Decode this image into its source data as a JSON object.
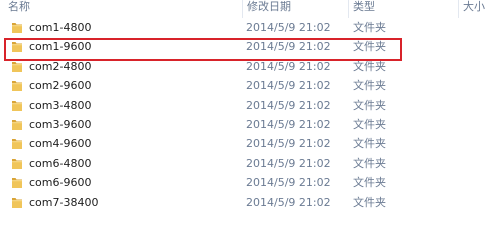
{
  "header": {
    "name_label": "名称",
    "date_label": "修改日期",
    "type_label": "类型",
    "size_label": "大小"
  },
  "rows": [
    {
      "name": "com1-4800",
      "date": "2014/5/9 21:02",
      "type": "文件夹"
    },
    {
      "name": "com1-9600",
      "date": "2014/5/9 21:02",
      "type": "文件夹"
    },
    {
      "name": "com2-4800",
      "date": "2014/5/9 21:02",
      "type": "文件夹"
    },
    {
      "name": "com2-9600",
      "date": "2014/5/9 21:02",
      "type": "文件夹"
    },
    {
      "name": "com3-4800",
      "date": "2014/5/9 21:02",
      "type": "文件夹"
    },
    {
      "name": "com3-9600",
      "date": "2014/5/9 21:02",
      "type": "文件夹"
    },
    {
      "name": "com4-9600",
      "date": "2014/5/9 21:02",
      "type": "文件夹"
    },
    {
      "name": "com6-4800",
      "date": "2014/5/9 21:02",
      "type": "文件夹"
    },
    {
      "name": "com6-9600",
      "date": "2014/5/9 21:02",
      "type": "文件夹"
    },
    {
      "name": "com7-38400",
      "date": "2014/5/9 21:02",
      "type": "文件夹"
    }
  ],
  "highlighted_row": "com1-9600",
  "colors": {
    "highlight": "#d8232a",
    "secondary_text": "#6b7b93",
    "folder": "#e8b84a"
  },
  "icons": {
    "folder": "folder-icon"
  }
}
